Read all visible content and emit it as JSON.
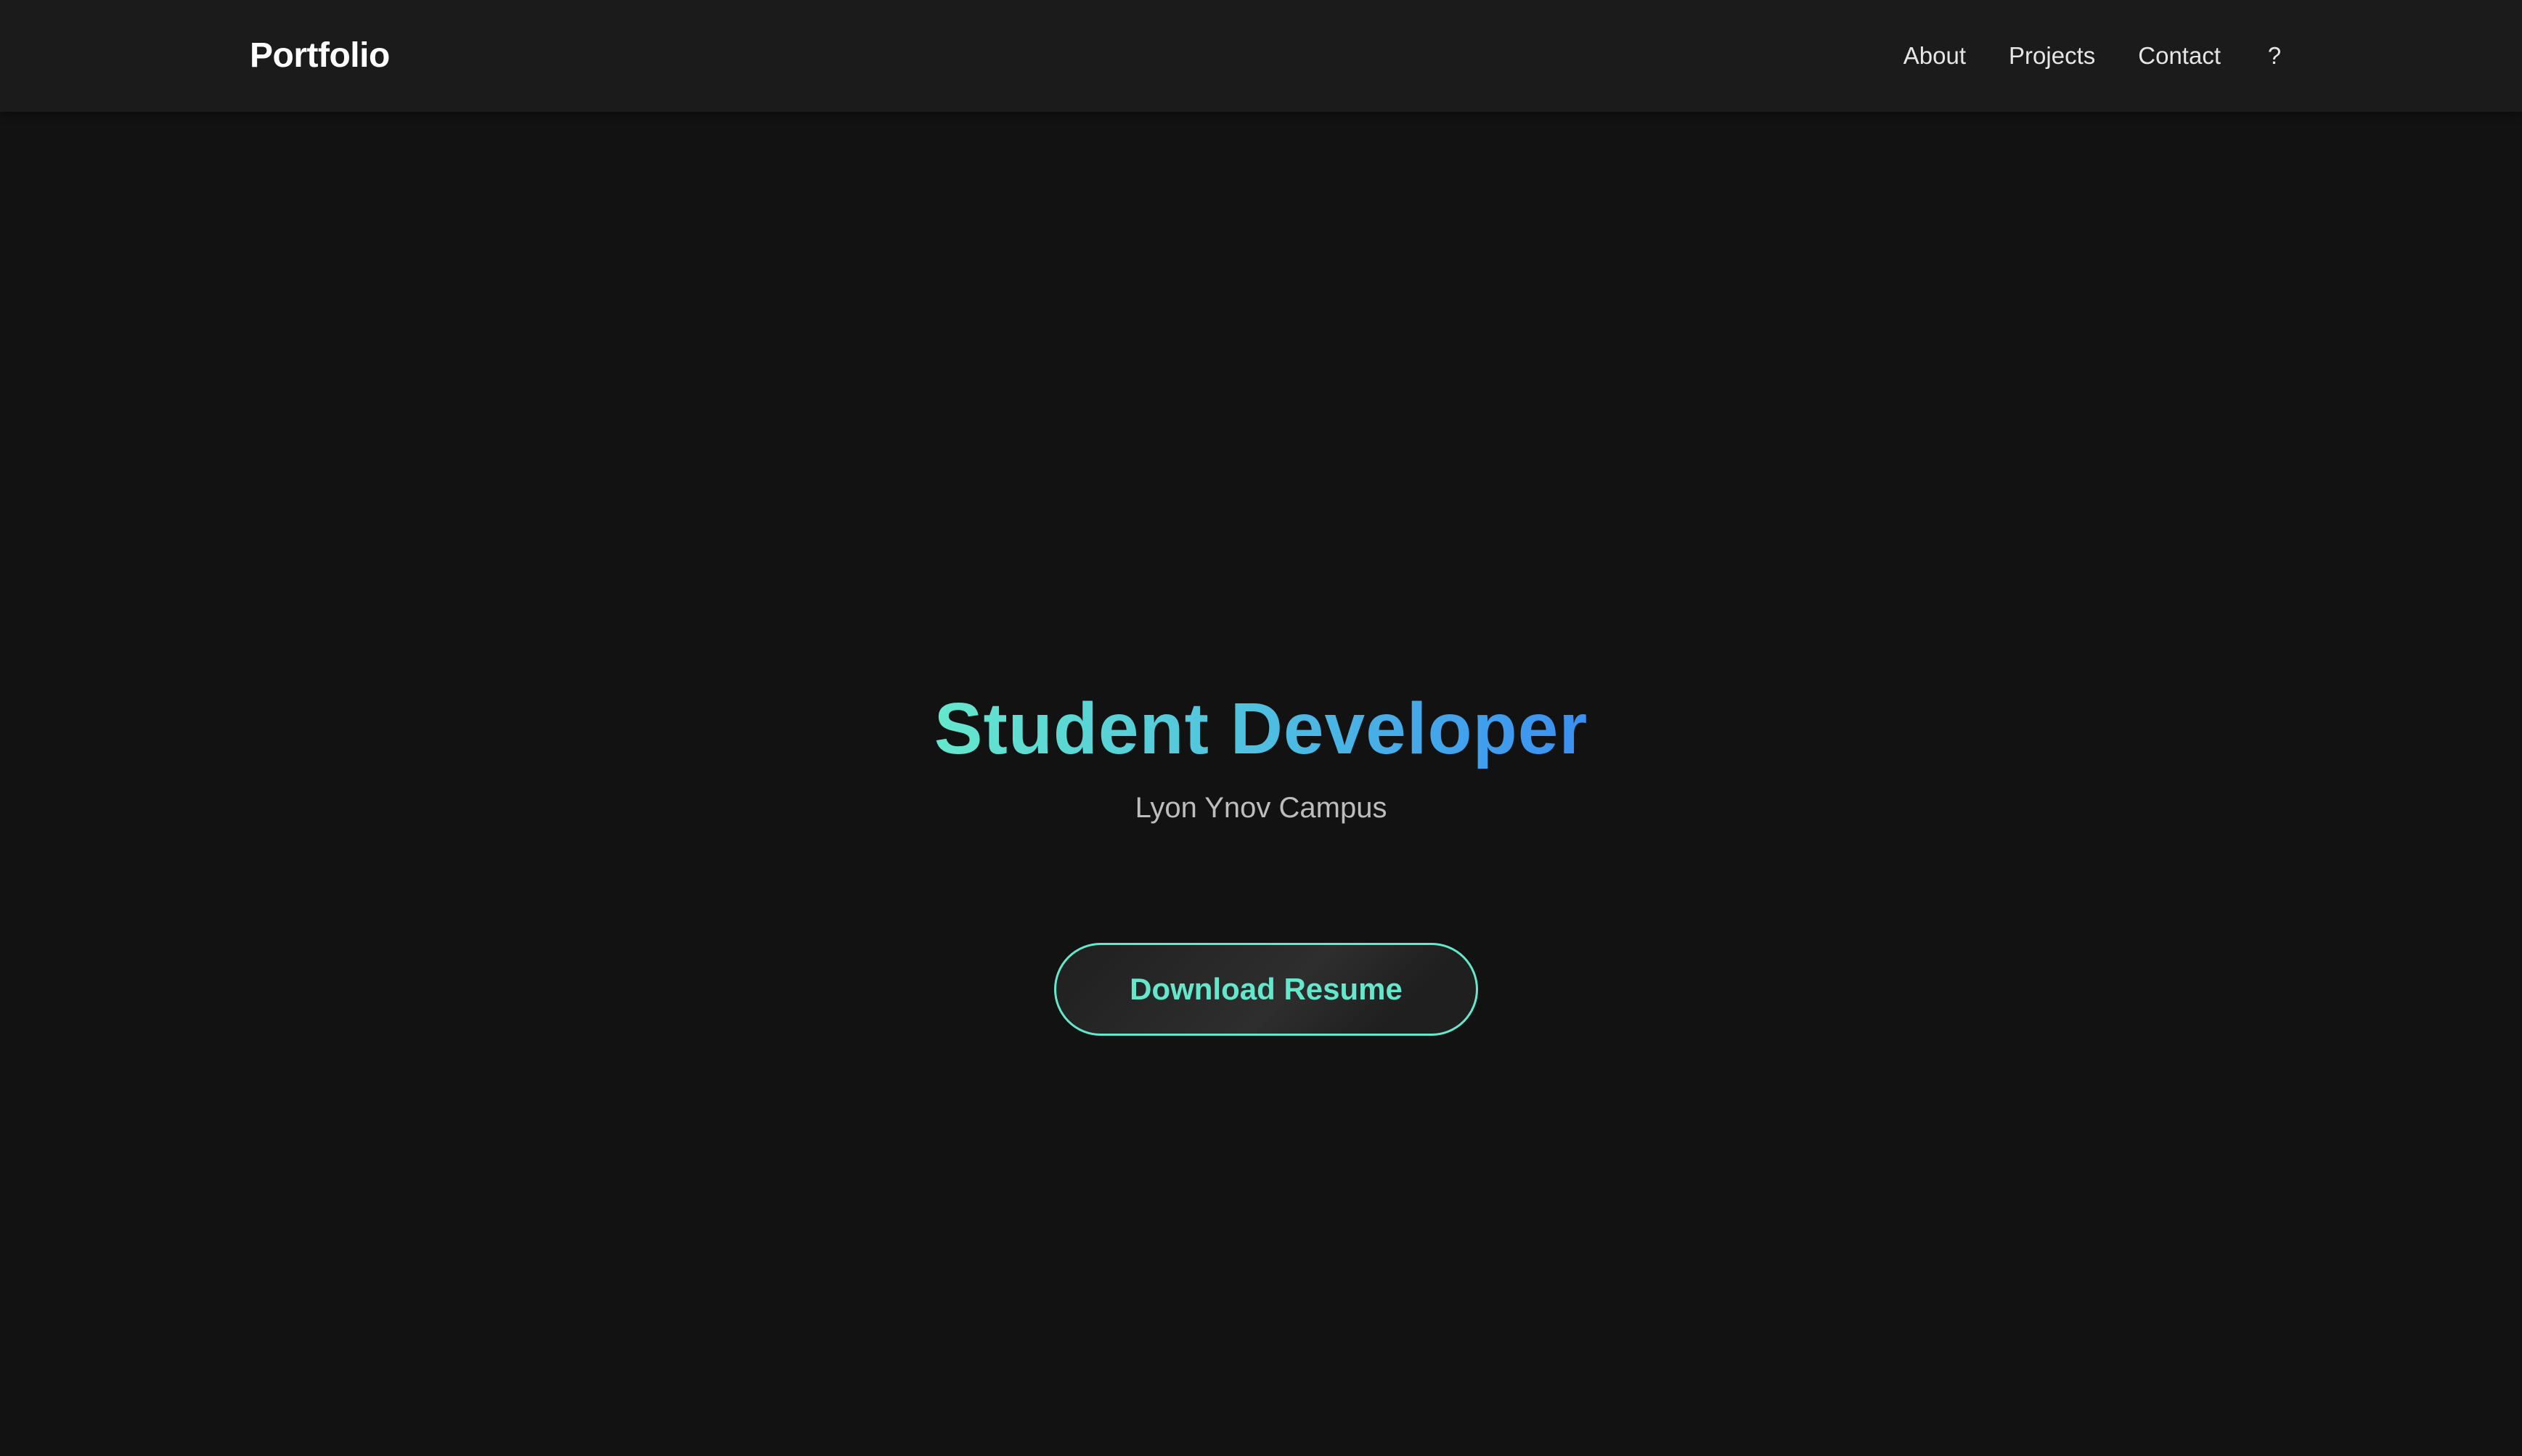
{
  "header": {
    "brand": "Portfolio",
    "nav": {
      "about": "About",
      "projects": "Projects",
      "contact": "Contact",
      "help": "?"
    }
  },
  "hero": {
    "title": "Student Developer",
    "subtitle": "Lyon Ynov Campus",
    "cta_label": "Download Resume"
  },
  "colors": {
    "background": "#121212",
    "header_background": "#1b1b1b",
    "accent": "#64e8cc",
    "gradient_end": "#3b8ff2"
  }
}
